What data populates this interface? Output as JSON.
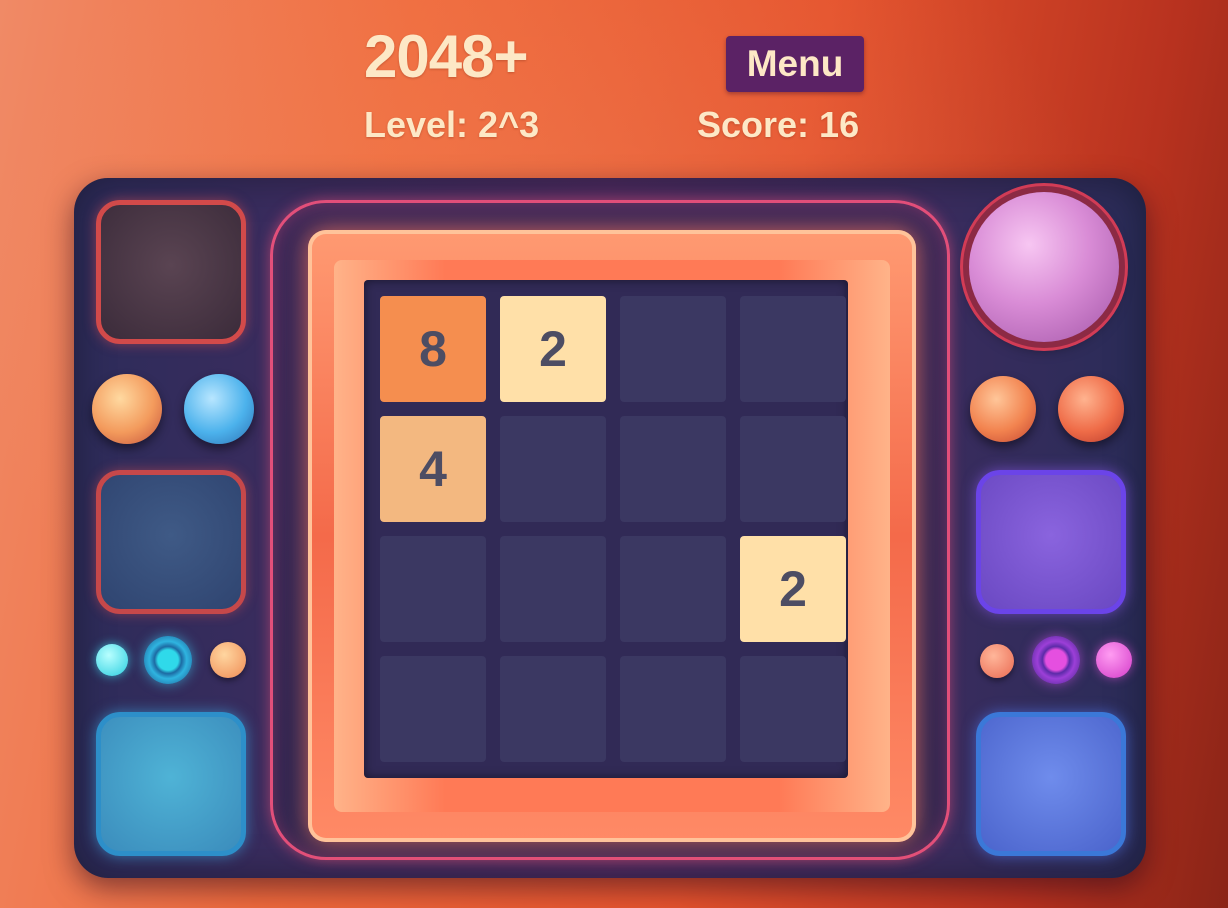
{
  "header": {
    "title": "2048+",
    "menu_label": "Menu",
    "level_text": "Level: 2^3",
    "score_text": "Score: 16"
  },
  "board": {
    "rows": 4,
    "cols": 4,
    "cells": [
      [
        "8",
        "2",
        "",
        ""
      ],
      [
        "4",
        "",
        "",
        ""
      ],
      [
        "",
        "",
        "",
        "2"
      ],
      [
        "",
        "",
        "",
        ""
      ]
    ]
  },
  "colors": {
    "menu_button": "#5b2265",
    "header_text": "#fde8c6",
    "empty_cell": "#3b3862",
    "tile_2": "#ffe0a8",
    "tile_4": "#f3b880",
    "tile_8": "#f58e4f",
    "tile_text": "#4d4d63"
  }
}
